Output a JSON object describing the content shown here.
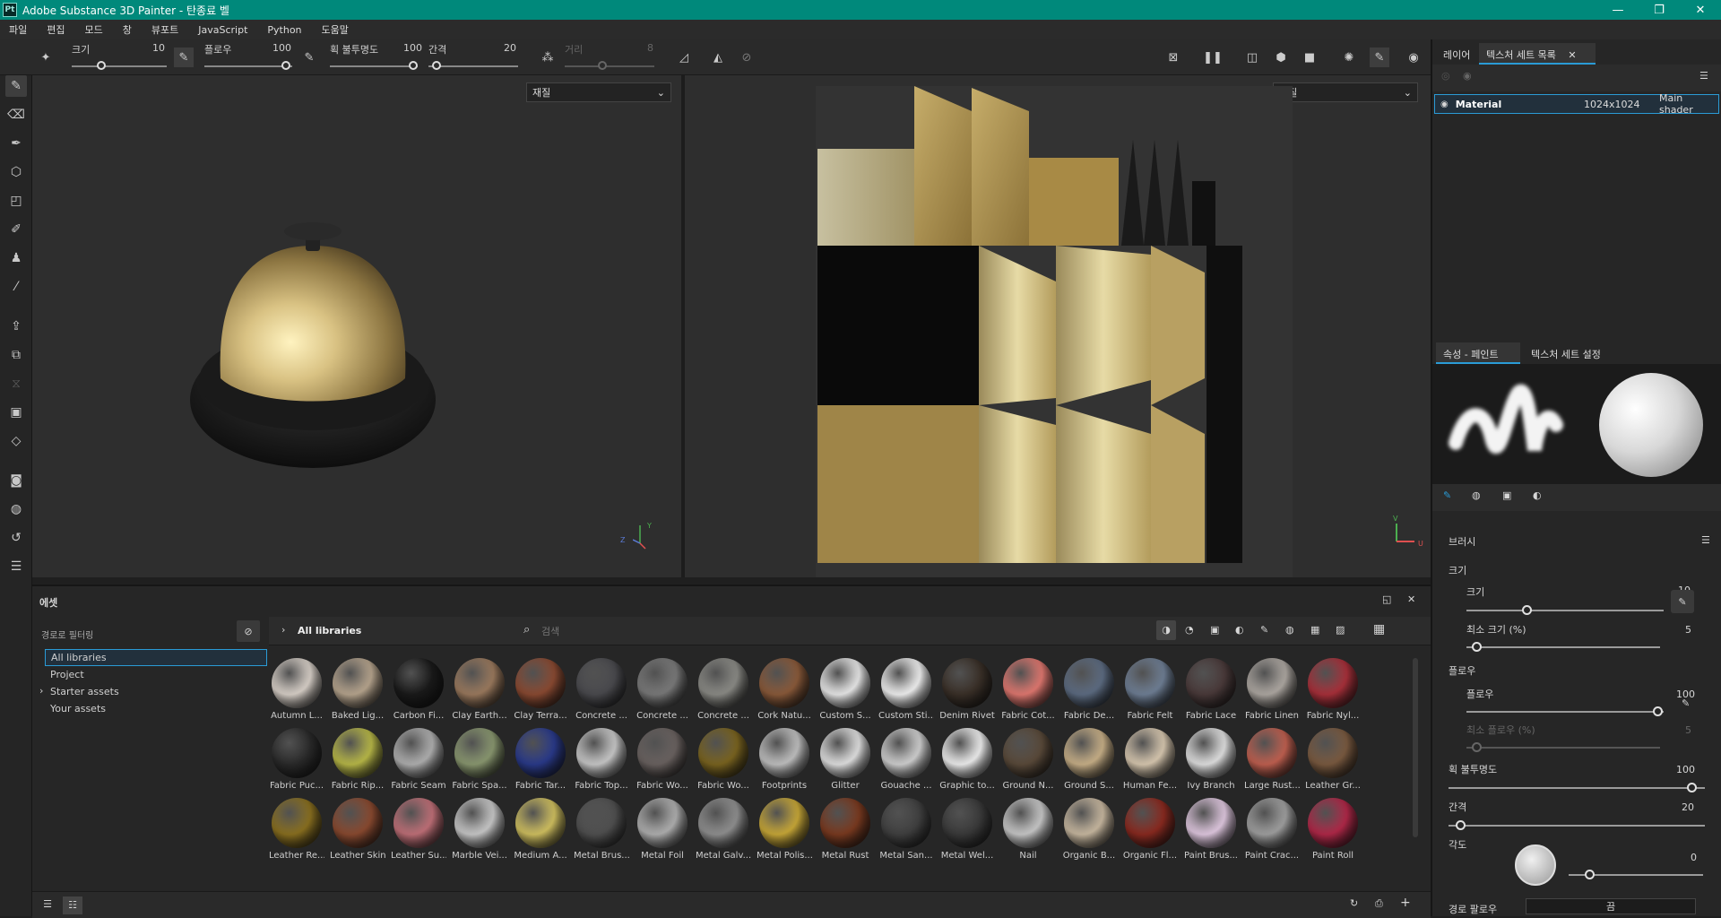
{
  "app": {
    "title": "Adobe Substance 3D Painter - 탄종료 벨",
    "logo": "Pt"
  },
  "menu": [
    "파일",
    "편집",
    "모드",
    "창",
    "뷰포트",
    "JavaScript",
    "Python",
    "도움말"
  ],
  "toolbar": {
    "size_label": "크기",
    "size_value": "10",
    "flow_label": "플로우",
    "flow_value": "100",
    "opacity_label": "획 불투명도",
    "opacity_value": "100",
    "spacing_label": "간격",
    "spacing_value": "20",
    "distance_label": "거리",
    "distance_value": "8"
  },
  "viewport": {
    "dropdown_3d": "재질",
    "dropdown_2d": "재질",
    "axis_x": "X",
    "axis_y": "Y",
    "axis_z": "Z",
    "uv_v": "V",
    "uv_u": "U"
  },
  "right_panel": {
    "tabs": [
      "레이어",
      "텍스처 세트 목록"
    ],
    "texture_set": {
      "name": "Material",
      "resolution": "1024x1024",
      "shader": "Main shader"
    },
    "prop_tabs": [
      "속성 - 페인트",
      "텍스처 세트 설정"
    ],
    "brush_section": "브러시",
    "size_section": "크기",
    "size_label": "크기",
    "size_value": "10",
    "min_size_label": "최소 크기 (%)",
    "min_size_value": "5",
    "flow_section": "플로우",
    "flow_label": "플로우",
    "flow_value": "100",
    "min_flow_label": "최소 플로우 (%)",
    "min_flow_value": "5",
    "stroke_opacity_label": "획 불투명도",
    "stroke_opacity_value": "100",
    "spacing_label": "간격",
    "spacing_value": "20",
    "angle_label": "각도",
    "angle_value": "0",
    "path_flow_label": "경로 팔로우",
    "path_flow_value": "끔"
  },
  "assets": {
    "title": "에셋",
    "path_filter": "경로로 필터링",
    "tree": [
      "All libraries",
      "Project",
      "Starter assets",
      "Your assets"
    ],
    "breadcrumb": "All libraries",
    "search_placeholder": "검색",
    "rows": [
      [
        "Autumn L...",
        "Baked Lig...",
        "Carbon Fi...",
        "Clay Earth...",
        "Clay Terra...",
        "Concrete ...",
        "Concrete ...",
        "Concrete ...",
        "Cork Natu...",
        "Custom S...",
        "Custom Sti...",
        "Denim Rivet",
        "Fabric Cot...",
        "Fabric De...",
        "Fabric Felt",
        "Fabric Lace",
        "Fabric Linen",
        "Fabric Nyl..."
      ],
      [
        "Fabric Puc...",
        "Fabric Rip...",
        "Fabric Seam",
        "Fabric Spa...",
        "Fabric Tar...",
        "Fabric Top...",
        "Fabric Wo...",
        "Fabric Wo...",
        "Footprints",
        "Glitter",
        "Gouache ...",
        "Graphic to...",
        "Ground N...",
        "Ground S...",
        "Human Fe...",
        "Ivy Branch",
        "Large Rust...",
        "Leather Gr..."
      ],
      [
        "Leather Re...",
        "Leather Skin",
        "Leather Su...",
        "Marble Vei...",
        "Medium A...",
        "Metal Brus...",
        "Metal Foil",
        "Metal Galv...",
        "Metal Polis...",
        "Metal Rust",
        "Metal San...",
        "Metal Wel...",
        "Nail",
        "Organic B...",
        "Organic Fl...",
        "Paint Brus...",
        "Paint Crac...",
        "Paint Roll"
      ]
    ],
    "colors": [
      [
        "#d8d0c8",
        "#b7a58e",
        "#1a1a1a",
        "#9b7a5e",
        "#8a4a32",
        "#4a4a4e",
        "#7a7a7a",
        "#8b8b86",
        "#8a5a3a",
        "#e8e8e8",
        "#f0f0f0",
        "#3a3028",
        "#e07870",
        "#5d6c82",
        "#6f7f95",
        "#4a3a3a",
        "#aea8a2",
        "#a8303a"
      ],
      [
        "#2a2a2a",
        "#b8b848",
        "#b0b0b0",
        "#8a9870",
        "#2a3a8a",
        "#c8c8c8",
        "#6a6260",
        "#7a6420",
        "#c0c0c0",
        "#e0e0e0",
        "#d0d0d0",
        "#eeeeee",
        "#5a4a3a",
        "#c8b088",
        "#d8c8b0",
        "#e0e0e0",
        "#c06050",
        "#7a5a40"
      ],
      [
        "#8a7020",
        "#8a4a30",
        "#c07078",
        "#c8c8c8",
        "#d0c060",
        "#505050",
        "#b0b0b0",
        "#909090",
        "#c8a838",
        "#7a3a20",
        "#404040",
        "#3a3a3a",
        "#c8c8c8",
        "#c8b8a0",
        "#8a2a20",
        "#e0c8e0",
        "#a0a0a0",
        "#b02848"
      ]
    ]
  }
}
